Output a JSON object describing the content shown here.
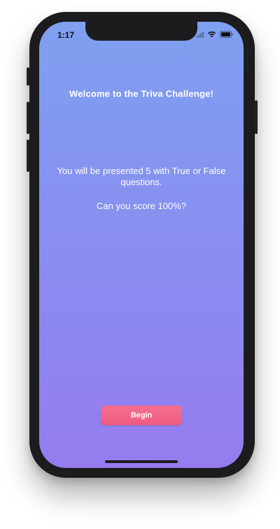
{
  "status_bar": {
    "time": "1:17",
    "icons": [
      "signal-icon",
      "wifi-icon",
      "battery-icon"
    ]
  },
  "screen": {
    "title": "Welcome to the Triva Challenge!",
    "intro": "You will be presented 5 with True or False questions.",
    "question": "Can you score 100%?",
    "begin_label": "Begin"
  },
  "colors": {
    "gradient_top": "#7fa0f0",
    "gradient_bottom": "#957cef",
    "button": "#f0648a",
    "device": "#1c1c1e"
  }
}
